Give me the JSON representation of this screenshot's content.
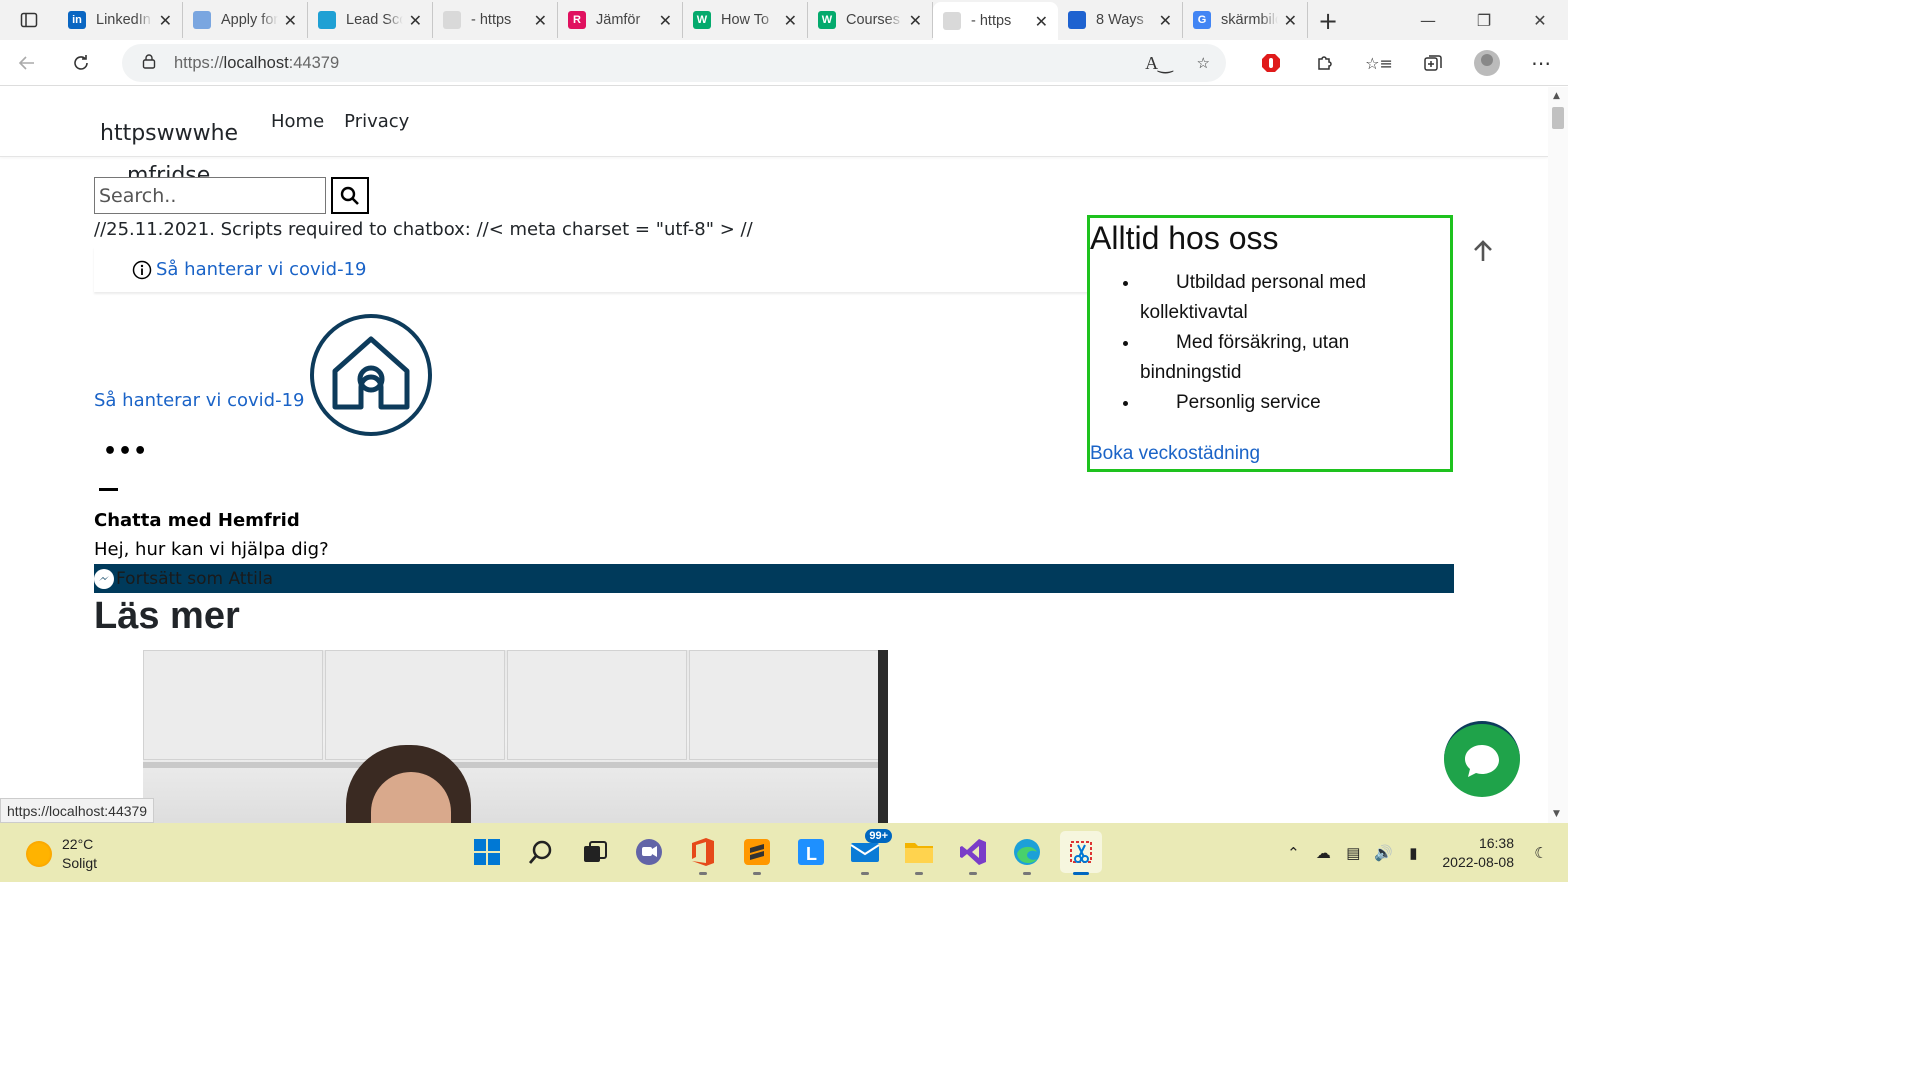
{
  "browser": {
    "tabs": [
      {
        "title": "LinkedIn",
        "icon": "linkedin-icon",
        "color": "#0a66c2",
        "glyph": "in"
      },
      {
        "title": "Apply for",
        "icon": "apply-icon",
        "color": "#7aa6e0",
        "glyph": ""
      },
      {
        "title": "Lead Score",
        "icon": "lead-icon",
        "color": "#1fa0d4",
        "glyph": ""
      },
      {
        "title": "- https",
        "icon": "page-icon",
        "color": "#d9d9d9",
        "glyph": ""
      },
      {
        "title": "Jämför",
        "icon": "r-icon",
        "color": "#e0115f",
        "glyph": "R"
      },
      {
        "title": "How To",
        "icon": "w-icon",
        "color": "#04aa6d",
        "glyph": "W"
      },
      {
        "title": "Courses",
        "icon": "w3schools-icon",
        "color": "#04aa6d",
        "glyph": "W"
      },
      {
        "title": "- https",
        "icon": "page-icon",
        "color": "#d9d9d9",
        "glyph": "",
        "active": true
      },
      {
        "title": "8 Ways",
        "icon": "ways-icon",
        "color": "#1e62d0",
        "glyph": ""
      },
      {
        "title": "skärmbild",
        "icon": "google-icon",
        "color": "#4285f4",
        "glyph": "G"
      }
    ],
    "url_scheme": "https://",
    "url_host": "localhost",
    "url_port": ":44379",
    "status_url": "https://localhost:44379"
  },
  "site": {
    "brand_line1": "httpswwwhe",
    "brand_line2": "mfridse",
    "nav": [
      "Home",
      "Privacy"
    ],
    "search_placeholder": "Search..",
    "script_note": "//25.11.2021. Scripts required to chatbox: //< meta charset = \"utf-8\" > //",
    "covid_link": "Så hanterar vi covid-19",
    "covid_link2": "Så hanterar vi covid-19",
    "chat_title": "Chatta med Hemfrid",
    "chat_message": "Hej, hur kan vi hjälpa dig?",
    "messenger_text": "Fortsätt som Attila",
    "read_more": "Läs mer",
    "sidebox": {
      "heading": "Alltid hos oss",
      "items": [
        "Utbildad personal med kollektivavtal",
        "Med försäkring, utan bindningstid",
        "Personlig service"
      ],
      "link": "Boka veckostädning"
    }
  },
  "taskbar": {
    "temp": "22°C",
    "weather": "Soligt",
    "mail_badge": "99+",
    "time": "16:38",
    "date": "2022-08-08"
  },
  "colors": {
    "accent_link": "#1a63c7",
    "border_green": "#1ec21e",
    "dark_navy": "#003a5b",
    "chat_green": "#1fa34a",
    "taskbar_bg": "#eaeab6"
  }
}
